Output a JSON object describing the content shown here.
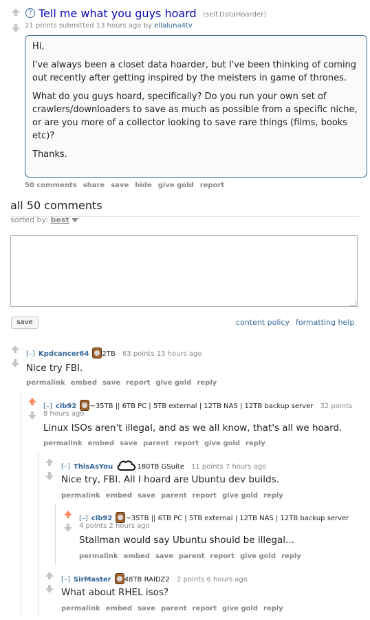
{
  "post": {
    "title": "Tell me what you guys hoard",
    "domain": "(self.DataHoarder)",
    "tagline_prefix": "21 points submitted 13 hours ago by",
    "author": "ellaluna4tv",
    "paragraphs": [
      "Hi,",
      "I've always been a closet data hoarder, but I've been thinking of coming out recently after getting inspired by the meisters in game of thrones.",
      "What do you guys hoard, specifically? Do you run your own set of crawlers/downloaders to save as much as possible from a specific niche, or are you more of a collector looking to save rare things (films, books etc)?",
      "Thanks."
    ],
    "buttons": [
      "50 comments",
      "share",
      "save",
      "hide",
      "give gold",
      "report"
    ]
  },
  "comments_area": {
    "heading": "all 50 comments",
    "sorted_by_label": "sorted by:",
    "sort_value": "best",
    "save_button": "save",
    "content_policy": "content policy",
    "formatting_help": "formatting help"
  },
  "comments": [
    {
      "expand": "[–]",
      "author": "Kpdcancer64",
      "flair": "2TB",
      "meta": "63 points 13 hours ago",
      "meta2": "",
      "body": "Nice try FBI.",
      "buttons": [
        "permalink",
        "embed",
        "save",
        "report",
        "give gold",
        "reply"
      ]
    },
    {
      "expand": "[–]",
      "author": "clb92",
      "flair": "~35TB || 6TB PC | 5TB external | 12TB NAS | 12TB backup server",
      "meta": "32 points",
      "meta2": "8 hours ago",
      "body": "Linux ISOs aren't illegal, and as we all know, that's all we hoard.",
      "buttons": [
        "permalink",
        "embed",
        "save",
        "parent",
        "report",
        "give gold",
        "reply"
      ]
    },
    {
      "expand": "[–]",
      "author": "ThisAsYou",
      "flair": "180TB GSuite",
      "meta": "11 points 7 hours ago",
      "meta2": "",
      "body": "Nice try, FBI. All I hoard are Ubuntu dev builds.",
      "buttons": [
        "permalink",
        "embed",
        "save",
        "parent",
        "report",
        "give gold",
        "reply"
      ]
    },
    {
      "expand": "[–]",
      "author": "clb92",
      "flair": "~35TB || 6TB PC | 5TB external | 12TB NAS | 12TB backup server",
      "meta": "",
      "meta2": "4 points 2 hours ago",
      "body": "Stallman would say Ubuntu should be illegal...",
      "buttons": [
        "permalink",
        "embed",
        "save",
        "parent",
        "report",
        "give gold",
        "reply"
      ]
    },
    {
      "expand": "[–]",
      "author": "SirMaster",
      "flair": "48TB RAIDZ2",
      "meta": "2 points 6 hours ago",
      "meta2": "",
      "body": "What about RHEL isos?",
      "buttons": [
        "permalink",
        "embed",
        "save",
        "parent",
        "report",
        "give gold",
        "reply"
      ]
    }
  ]
}
